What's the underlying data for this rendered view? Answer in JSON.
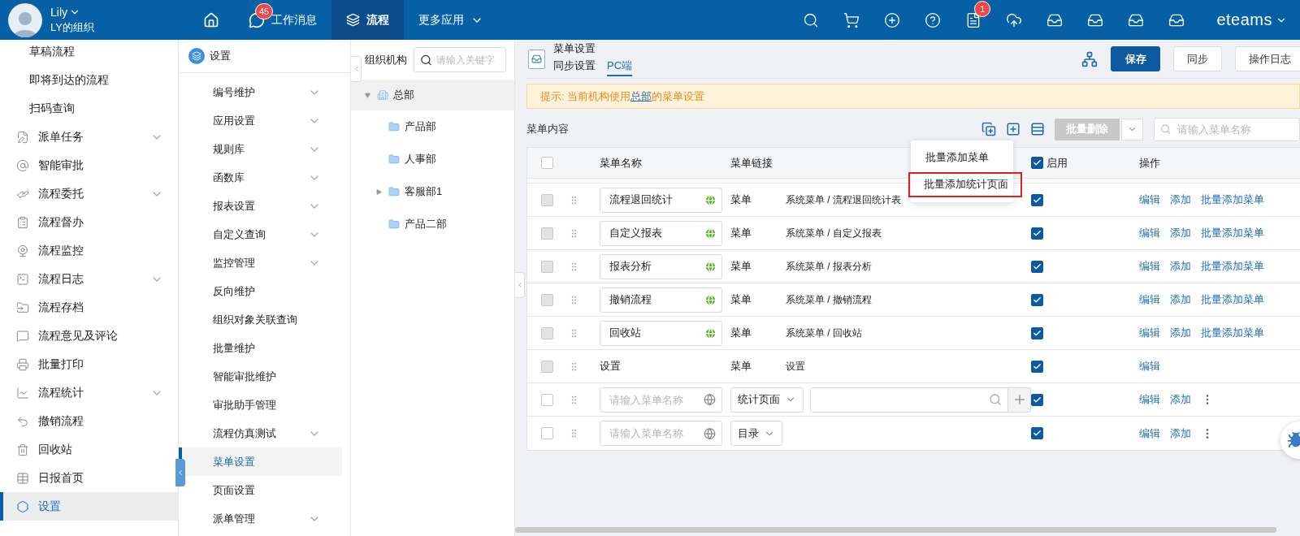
{
  "top_bar": {
    "user": {
      "name": "Lily",
      "org": "LY的组织"
    },
    "nav": [
      {
        "kind": "home",
        "selected": false
      },
      {
        "kind": "messages",
        "label": "工作消息",
        "badge": "45",
        "selected": false
      },
      {
        "kind": "flow",
        "label": "流程",
        "selected": true
      },
      {
        "kind": "more",
        "label": "更多应用",
        "selected": false
      }
    ],
    "tools": [
      {
        "kind": "search"
      },
      {
        "kind": "cart"
      },
      {
        "kind": "plus"
      },
      {
        "kind": "help"
      },
      {
        "kind": "notes",
        "badge": "1"
      },
      {
        "kind": "cloud"
      },
      {
        "kind": "inbox"
      },
      {
        "kind": "inbox"
      },
      {
        "kind": "inbox"
      },
      {
        "kind": "inbox"
      }
    ],
    "brand": "eteams"
  },
  "sidebar": {
    "items": [
      {
        "label": "草稿流程",
        "expandable": false,
        "selected": false
      },
      {
        "label": "即将到达的流程",
        "expandable": false,
        "selected": false
      },
      {
        "label": "扫码查询",
        "expandable": false,
        "selected": false
      },
      {
        "label": "派单任务",
        "expandable": true,
        "selected": false
      },
      {
        "label": "智能审批",
        "expandable": false,
        "selected": false
      },
      {
        "label": "流程委托",
        "expandable": true,
        "selected": false
      },
      {
        "label": "流程督办",
        "expandable": false,
        "selected": false
      },
      {
        "label": "流程监控",
        "expandable": false,
        "selected": false
      },
      {
        "label": "流程日志",
        "expandable": true,
        "selected": false
      },
      {
        "label": "流程存档",
        "expandable": false,
        "selected": false
      },
      {
        "label": "流程意见及评论",
        "expandable": false,
        "selected": false
      },
      {
        "label": "批量打印",
        "expandable": false,
        "selected": false
      },
      {
        "label": "流程统计",
        "expandable": true,
        "selected": false
      },
      {
        "label": "撤销流程",
        "expandable": false,
        "selected": false
      },
      {
        "label": "回收站",
        "expandable": false,
        "selected": false
      },
      {
        "label": "日报首页",
        "expandable": false,
        "selected": false
      },
      {
        "label": "设置",
        "expandable": false,
        "selected": true
      }
    ]
  },
  "submenu": {
    "title": "设置",
    "items": [
      {
        "label": "编号维护",
        "expandable": true,
        "selected": false
      },
      {
        "label": "应用设置",
        "expandable": true,
        "selected": false
      },
      {
        "label": "规则库",
        "expandable": true,
        "selected": false
      },
      {
        "label": "函数库",
        "expandable": true,
        "selected": false
      },
      {
        "label": "报表设置",
        "expandable": true,
        "selected": false
      },
      {
        "label": "自定义查询",
        "expandable": true,
        "selected": false
      },
      {
        "label": "监控管理",
        "expandable": true,
        "selected": false
      },
      {
        "label": "反向维护",
        "expandable": false,
        "selected": false
      },
      {
        "label": "组织对象关联查询",
        "expandable": false,
        "selected": false
      },
      {
        "label": "批量维护",
        "expandable": false,
        "selected": false
      },
      {
        "label": "智能审批维护",
        "expandable": false,
        "selected": false
      },
      {
        "label": "审批助手管理",
        "expandable": false,
        "selected": false
      },
      {
        "label": "流程仿真测试",
        "expandable": true,
        "selected": false
      },
      {
        "label": "菜单设置",
        "expandable": false,
        "selected": true
      },
      {
        "label": "页面设置",
        "expandable": false,
        "selected": false
      },
      {
        "label": "派单管理",
        "expandable": true,
        "selected": false
      }
    ]
  },
  "org_tree": {
    "title": "组织机构",
    "search": {
      "placeholder": "请输入关键字"
    },
    "nodes": [
      {
        "label": "总部",
        "kind": "company",
        "expanded": true,
        "selected": true,
        "children": [
          {
            "label": "产品部",
            "kind": "department",
            "expanded": false,
            "selected": false,
            "has_children": false
          },
          {
            "label": "人事部",
            "kind": "department",
            "expanded": false,
            "selected": false,
            "has_children": false
          },
          {
            "label": "客服部1",
            "kind": "department",
            "expanded": false,
            "selected": false,
            "has_children": true
          },
          {
            "label": "产品二部",
            "kind": "department",
            "expanded": false,
            "selected": false,
            "has_children": false
          }
        ]
      }
    ]
  },
  "main": {
    "title": "菜单设置",
    "tabs": [
      {
        "label": "同步设置",
        "selected": false
      },
      {
        "label": "PC端",
        "selected": true
      }
    ],
    "buttons": [
      {
        "label": "保存",
        "kind": "primary"
      },
      {
        "label": "同步",
        "kind": "default"
      },
      {
        "label": "操作日志",
        "kind": "default"
      }
    ],
    "notice": {
      "text_before": "提示: 当前机构使用",
      "link": "总部",
      "text_after": "的菜单设置"
    },
    "section_title": "菜单内容",
    "batch_delete": {
      "label": "批量删除",
      "disabled": true
    },
    "search": {
      "placeholder": "请输入菜单名称"
    },
    "dropdown": {
      "items": [
        {
          "label": "批量添加菜单",
          "highlighted": false
        },
        {
          "label": "批量添加统计页面",
          "highlighted": true
        }
      ]
    },
    "table": {
      "select_all": {
        "checked": false
      },
      "columns": [
        "菜单名称",
        "菜单链接",
        "启用",
        "操作"
      ],
      "enable_all": {
        "checked": true
      },
      "rows": [
        {
          "kind": "system",
          "name": "流程退回统计",
          "type": "菜单",
          "link": "系统菜单 / 流程退回统计表",
          "selected": false,
          "disabled": true,
          "enabled": true,
          "actions": [
            "编辑",
            "添加",
            "批量添加菜单"
          ]
        },
        {
          "kind": "system",
          "name": "自定义报表",
          "type": "菜单",
          "link": "系统菜单 / 自定义报表",
          "selected": false,
          "disabled": true,
          "enabled": true,
          "actions": [
            "编辑",
            "添加",
            "批量添加菜单"
          ]
        },
        {
          "kind": "system",
          "name": "报表分析",
          "type": "菜单",
          "link": "系统菜单 / 报表分析",
          "selected": false,
          "disabled": true,
          "enabled": true,
          "actions": [
            "编辑",
            "添加",
            "批量添加菜单"
          ]
        },
        {
          "kind": "system",
          "name": "撤销流程",
          "type": "菜单",
          "link": "系统菜单 / 撤销流程",
          "selected": false,
          "disabled": true,
          "enabled": true,
          "actions": [
            "编辑",
            "添加",
            "批量添加菜单"
          ]
        },
        {
          "kind": "system",
          "name": "回收站",
          "type": "菜单",
          "link": "系统菜单 / 回收站",
          "selected": false,
          "disabled": true,
          "enabled": true,
          "actions": [
            "编辑",
            "添加",
            "批量添加菜单"
          ]
        },
        {
          "kind": "plain",
          "name": "设置",
          "type": "菜单",
          "link": "设置",
          "selected": false,
          "disabled": true,
          "enabled": true,
          "actions": [
            "编辑"
          ]
        },
        {
          "kind": "new",
          "placeholder": "请输入菜单名称",
          "type": "统计页面",
          "has_link_field": true,
          "selected": false,
          "disabled": false,
          "enabled": true,
          "actions": [
            "编辑",
            "添加"
          ]
        },
        {
          "kind": "new",
          "placeholder": "请输入菜单名称",
          "type": "目录",
          "has_link_field": false,
          "selected": false,
          "disabled": false,
          "enabled": true,
          "actions": [
            "编辑",
            "添加"
          ]
        }
      ]
    }
  }
}
